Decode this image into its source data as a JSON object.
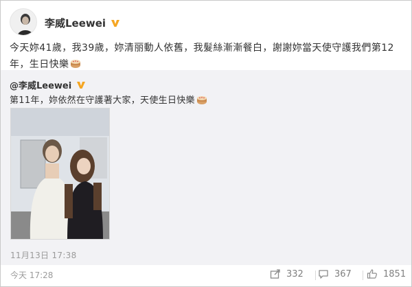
{
  "post": {
    "author": "李威Leewei",
    "verified_badge_color": "#f5a623",
    "text": "今天妳41歲，我39歲，妳清丽動人依舊，我髮絲漸漸餐白，謝謝妳當天使守護我們第12年，生日快樂",
    "emoji": "cake-emoji"
  },
  "repost": {
    "author": "@李威Leewei",
    "text": "第11年，妳依然在守護著大家，天使生日快樂",
    "emoji": "cake-emoji",
    "time": "11月13日 17:38"
  },
  "footer": {
    "time": "今天 17:28",
    "share_count": "332",
    "comment_count": "367",
    "like_count": "1851"
  }
}
